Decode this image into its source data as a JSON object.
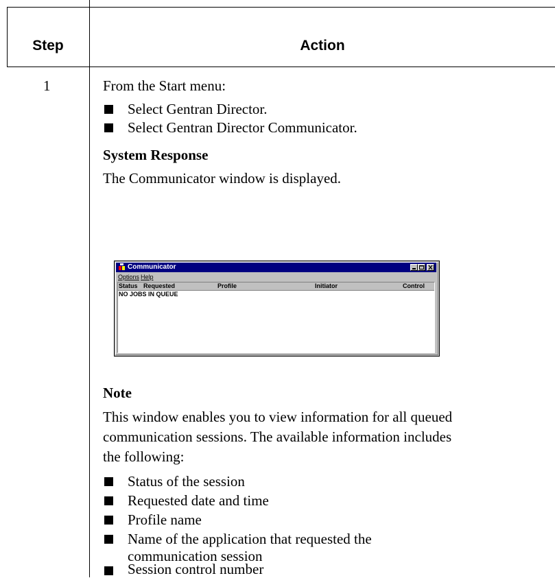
{
  "table": {
    "header_step": "Step",
    "header_action": "Action"
  },
  "step": {
    "number": "1",
    "intro": "From the Start menu:",
    "bullets": [
      "Select Gentran Director.",
      "Select Gentran Director Communicator."
    ],
    "system_response_heading": "System Response",
    "system_response_text": "The Communicator window is displayed.",
    "note_heading": "Note",
    "note_lines": [
      "This window enables you to view information for all queued",
      "communication sessions. The available information includes",
      "the following:"
    ],
    "note_bullets": [
      "Status of the session",
      "Requested date and time",
      "Profile name",
      "Name of the application that requested the",
      "communication session",
      "Session control number"
    ]
  },
  "window": {
    "title": "Communicator",
    "menus": [
      "Options",
      "Help"
    ],
    "columns": [
      "Status",
      "Requested",
      "Profile",
      "Initiator",
      "Control"
    ],
    "empty_text": "NO JOBS IN QUEUE",
    "title_bar_color": "#000080",
    "face_color": "#c0c0c0",
    "icons": [
      "app-icon",
      "minimize-icon",
      "maximize-icon",
      "close-icon"
    ]
  }
}
